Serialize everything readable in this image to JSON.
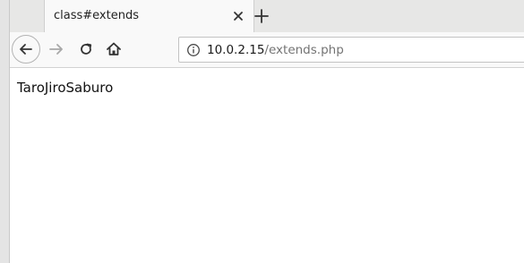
{
  "tab": {
    "title": "class#extends"
  },
  "toolbar": {
    "url_host": "10.0.2.15",
    "url_path": "/extends.php"
  },
  "page": {
    "body_text": "TaroJiroSaburo"
  },
  "icons": {
    "tab_close": "close-icon",
    "new_tab": "plus-icon",
    "back": "arrow-left-icon",
    "forward": "arrow-right-icon",
    "reload": "reload-icon",
    "home": "home-icon",
    "site_info": "info-icon"
  }
}
